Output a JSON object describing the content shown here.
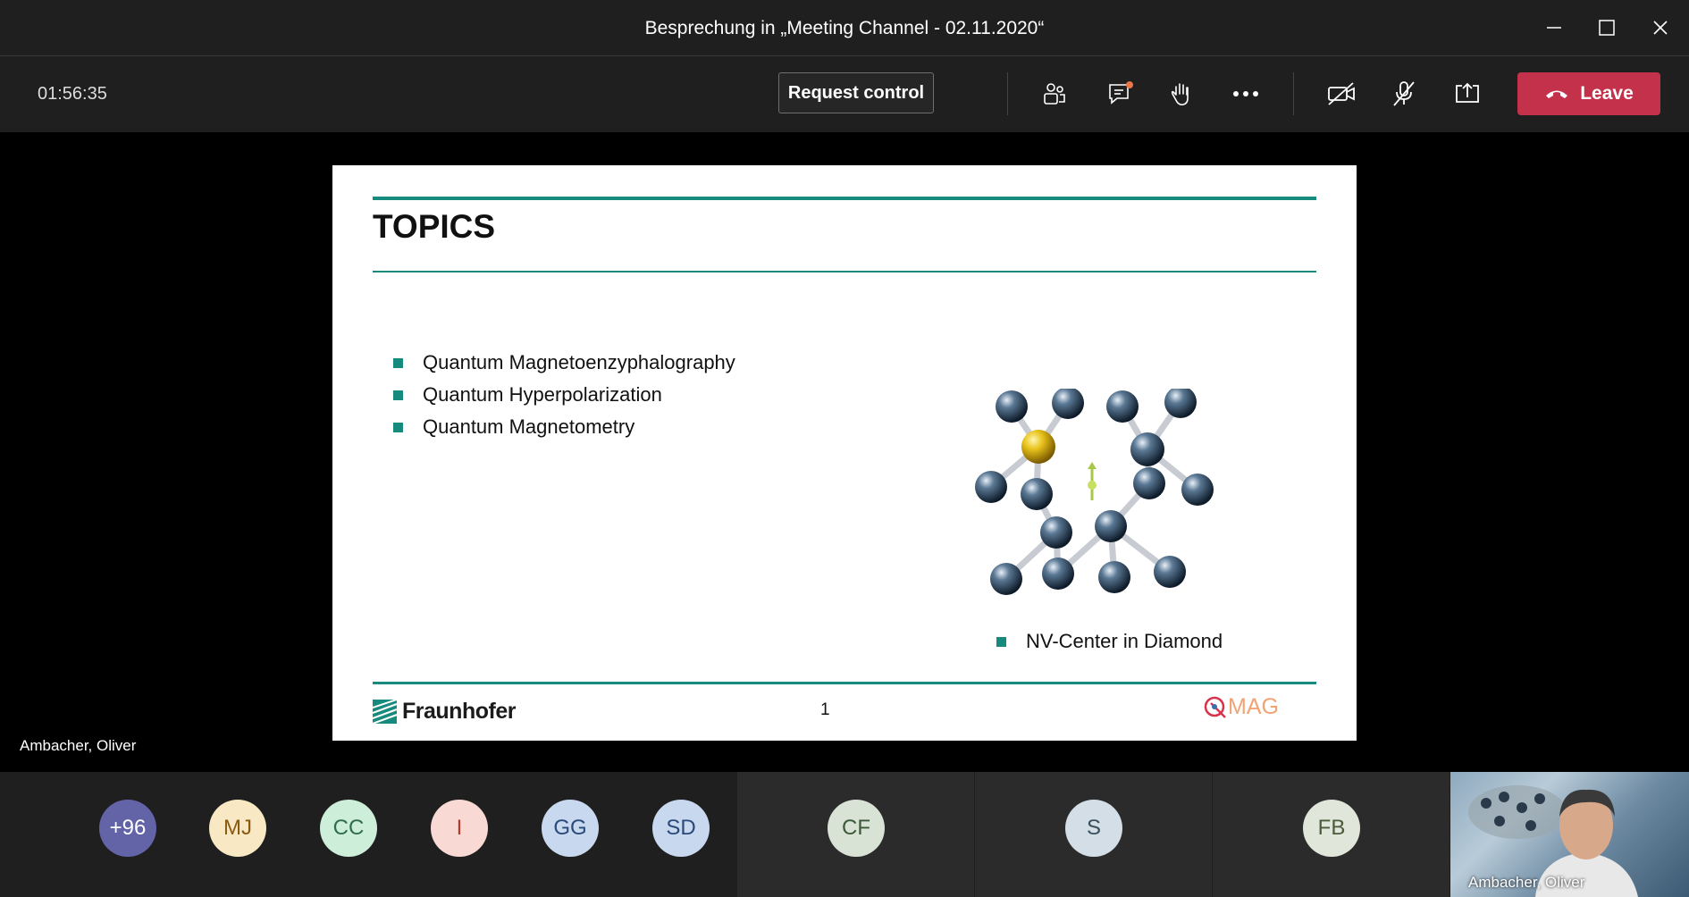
{
  "window": {
    "title": "Besprechung in „Meeting Channel - 02.11.2020“"
  },
  "toolbar": {
    "timer": "01:56:35",
    "request_control_label": "Request control",
    "leave_label": "Leave",
    "leave_color": "#c4314b",
    "icons": [
      "participants-icon",
      "chat-icon",
      "raise-hand-icon",
      "more-options-icon",
      "camera-off-icon",
      "mic-off-icon",
      "share-screen-icon",
      "phone-hangup-icon"
    ]
  },
  "slide": {
    "title": "TOPICS",
    "topics": [
      "Quantum Magnetoenzyphalography",
      "Quantum Hyperpolarization",
      "Quantum Magnetometry"
    ],
    "caption": "NV-Center in Diamond",
    "footer_logo_text": "Fraunhofer",
    "page_number": "1",
    "qmag_text": "MAG",
    "accent_color": "#178a7e"
  },
  "presenter": {
    "name": "Ambacher, Oliver"
  },
  "participants": {
    "initials": [
      {
        "text": "+96",
        "bg": "#6264a7",
        "fg": "#ffffff"
      },
      {
        "text": "MJ",
        "bg": "#f8e8c4",
        "fg": "#8a5a10"
      },
      {
        "text": "CC",
        "bg": "#cdeed9",
        "fg": "#2f6e4a"
      },
      {
        "text": "I",
        "bg": "#f9d9d4",
        "fg": "#b23a2a"
      },
      {
        "text": "GG",
        "bg": "#c8d8ef",
        "fg": "#2a4a7a"
      },
      {
        "text": "SD",
        "bg": "#c8d8ef",
        "fg": "#2a4a7a"
      }
    ],
    "tiles": [
      {
        "text": "CF",
        "bg": "#d8e3d6",
        "fg": "#3b5a38"
      },
      {
        "text": "S",
        "bg": "#d3dee6",
        "fg": "#3a4f5e"
      },
      {
        "text": "FB",
        "bg": "#e0e6da",
        "fg": "#4a5a3a"
      }
    ],
    "video_name": "Ambacher, Oliver"
  }
}
